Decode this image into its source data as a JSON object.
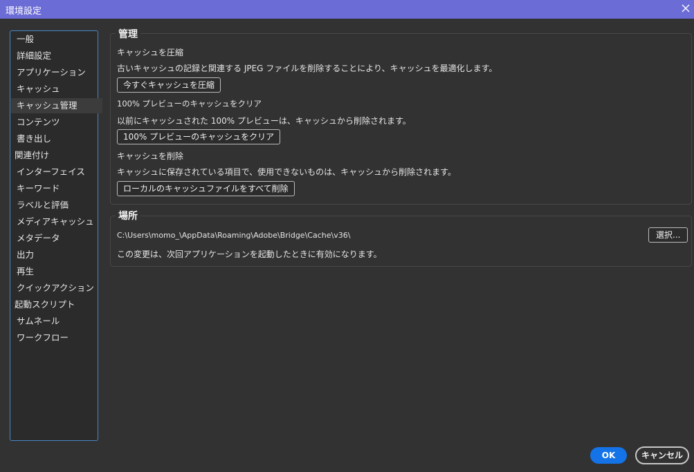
{
  "window": {
    "title": "環境設定"
  },
  "sidebar": {
    "items": [
      {
        "label": "一般"
      },
      {
        "label": "詳細設定"
      },
      {
        "label": "アプリケーション"
      },
      {
        "label": "キャッシュ"
      },
      {
        "label": "キャッシュ管理",
        "selected": true
      },
      {
        "label": "コンテンツ"
      },
      {
        "label": "書き出し"
      },
      {
        "label": "関連付け"
      },
      {
        "label": "インターフェイス"
      },
      {
        "label": "キーワード"
      },
      {
        "label": "ラベルと評価"
      },
      {
        "label": "メディアキャッシュ"
      },
      {
        "label": "メタデータ"
      },
      {
        "label": "出力"
      },
      {
        "label": "再生"
      },
      {
        "label": "クイックアクション"
      },
      {
        "label": "起動スクリプト"
      },
      {
        "label": "サムネール"
      },
      {
        "label": "ワークフロー"
      }
    ]
  },
  "management": {
    "title": "管理",
    "compact": {
      "heading": "キャッシュを圧縮",
      "description": "古いキャッシュの記録と関連する JPEG ファイルを削除することにより、キャッシュを最適化します。",
      "button": "今すぐキャッシュを圧縮"
    },
    "clear_preview": {
      "heading": "100% プレビューのキャッシュをクリア",
      "description": "以前にキャッシュされた 100% プレビューは、キャッシュから削除されます。",
      "button": "100% プレビューのキャッシュをクリア"
    },
    "delete_cache": {
      "heading": "キャッシュを削除",
      "description": "キャッシュに保存されている項目で、使用できないものは、キャッシュから削除されます。",
      "button": "ローカルのキャッシュファイルをすべて削除"
    }
  },
  "location": {
    "title": "場所",
    "path": "C:\\Users\\momo_\\AppData\\Roaming\\Adobe\\Bridge\\Cache\\v36\\",
    "choose_button": "選択...",
    "note": "この変更は、次回アプリケーションを起動したときに有効になります。"
  },
  "footer": {
    "ok": "OK",
    "cancel": "キャンセル"
  }
}
